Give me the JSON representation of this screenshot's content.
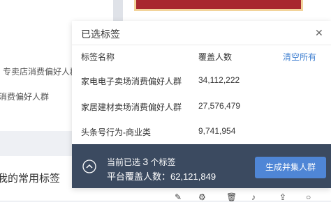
{
  "background": {
    "left_item_1": "专卖店消费偏好人群",
    "left_item_2": "消费偏好人群",
    "section_title": "我的常用标签"
  },
  "popup": {
    "title": "已选标签",
    "close_icon": "close-icon",
    "columns": {
      "name": "标签名称",
      "count": "覆盖人数"
    },
    "clear_all": "清空所有",
    "rows": [
      {
        "name": "家电电子卖场消费偏好人群",
        "count": "34,112,222"
      },
      {
        "name": "家居建材卖场消费偏好人群",
        "count": "27,576,479"
      },
      {
        "name": "头条号行为-商业类",
        "count": "9,741,954"
      }
    ],
    "footer": {
      "selected_prefix": "当前已选",
      "selected_count": "3",
      "selected_suffix": "个标签",
      "coverage_label": "平台覆盖人数：62,121,849",
      "generate_button": "生成并集人群"
    }
  },
  "colors": {
    "footer_bg": "#3b4a60",
    "button_bg": "#4f86d6",
    "link": "#3f7fd0",
    "banner": "#a8282f"
  }
}
